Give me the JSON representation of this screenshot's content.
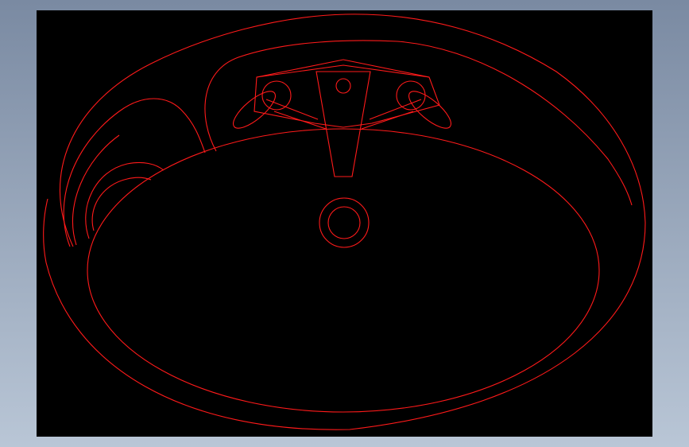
{
  "colors": {
    "background_top": "#7a8aa2",
    "background_bottom": "#b9c6d6",
    "canvas": "#000000",
    "line": "#ff1a1a"
  },
  "drawing": {
    "subject": "sink-top-view",
    "line_style": "wireframe"
  }
}
